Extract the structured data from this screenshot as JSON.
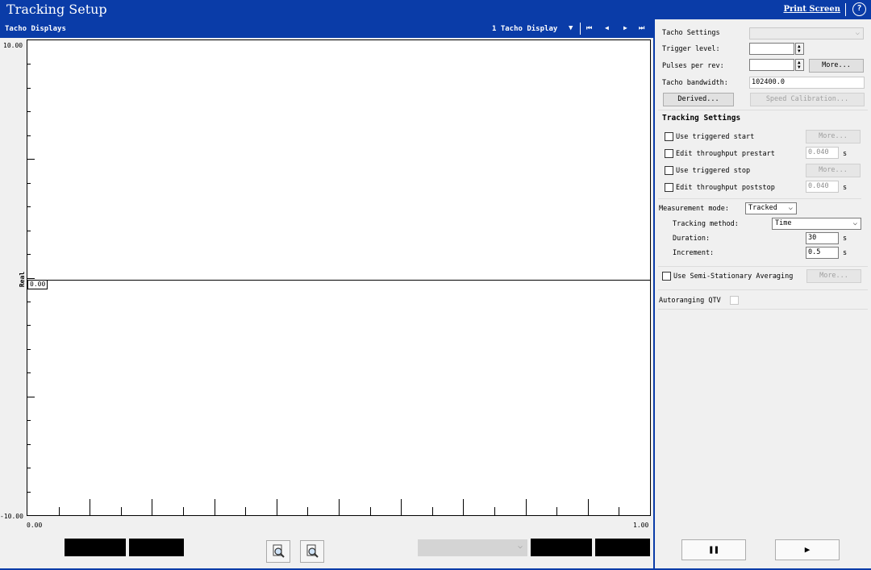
{
  "window": {
    "title": "Tracking Setup",
    "print_screen": "Print Screen",
    "help_glyph": "?"
  },
  "left": {
    "header": "Tacho Displays",
    "display_select": "1 Tacho Display",
    "nav": {
      "first": "⏮",
      "prev": "◀",
      "next": "▶",
      "last": "⏭"
    },
    "plot": {
      "y_max": "10.00",
      "y_min": "-10.00",
      "y_label": "Real",
      "x_min": "0.00",
      "x_max": "1.00",
      "cursor_value": "0.00"
    }
  },
  "right": {
    "tacho_settings": "Tacho Settings",
    "trigger_level": "Trigger level:",
    "pulses_per_rev": "Pulses per rev:",
    "more": "More...",
    "tacho_bandwidth": "Tacho bandwidth:",
    "tacho_bandwidth_value": "102400.0",
    "derived": "Derived...",
    "speed_calibration": "Speed Calibration...",
    "tracking_settings": "Tracking Settings",
    "use_triggered_start": "Use triggered start",
    "edit_throughput_prestart": "Edit throughput prestart",
    "prestart_value": "0.040",
    "use_triggered_stop": "Use triggered stop",
    "edit_throughput_poststop": "Edit throughput poststop",
    "poststop_value": "0.040",
    "unit_s": "s",
    "measurement_mode": "Measurement mode:",
    "measurement_mode_value": "Tracked",
    "tracking_method": "Tracking method:",
    "tracking_method_value": "Time",
    "duration": "Duration:",
    "duration_value": "30",
    "increment": "Increment:",
    "increment_value": "0.5",
    "semi_stationary": "Use Semi-Stationary Averaging",
    "autoranging": "Autoranging QTV",
    "pause_glyph": "❚❚",
    "play_glyph": "▶"
  },
  "icons": {
    "help": "help-icon",
    "zoom_in": "magnifier-icon",
    "zoom_out": "magnifier-icon",
    "pause": "pause-icon",
    "play": "play-icon"
  }
}
